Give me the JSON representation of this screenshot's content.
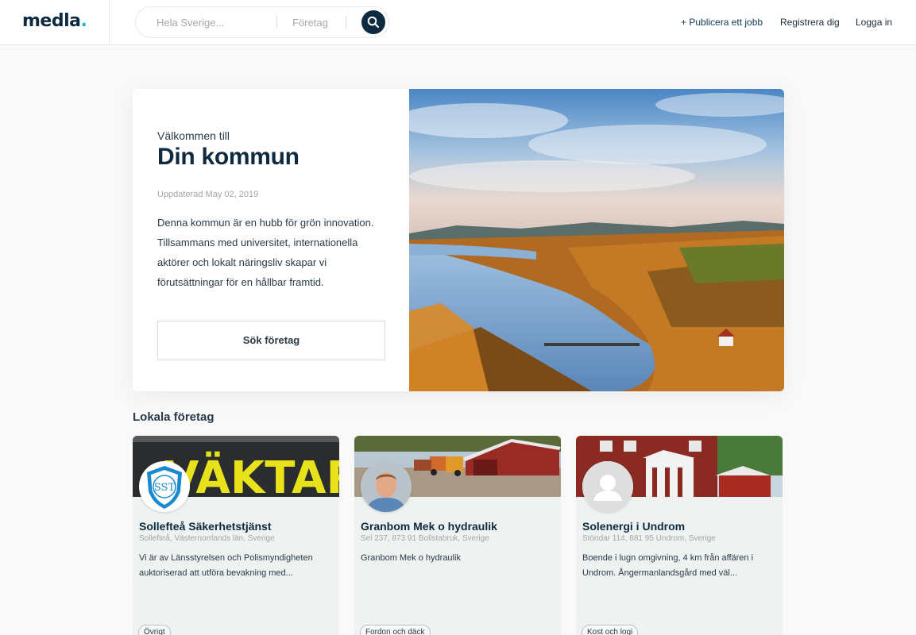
{
  "header": {
    "logo": "medla",
    "logo_dot": ".",
    "search": {
      "location_placeholder": "Hela Sverige...",
      "category_placeholder": "Företag"
    },
    "nav": {
      "publish": "+ Publicera ett jobb",
      "register": "Registrera dig",
      "login": "Logga in"
    }
  },
  "hero": {
    "welcome": "Välkommen till",
    "title": "Din kommun",
    "updated": "Uppdaterad May 02, 2019",
    "description": "Denna kommun är en hubb för grön innovation. Tillsammans med universitet, internationella aktörer och lokalt näringsliv skapar vi förutsättningar för en hållbar framtid.",
    "button": "Sök företag"
  },
  "section": {
    "title": "Lokala företag"
  },
  "companies": [
    {
      "name": "Sollefteå Säkerhetstjänst",
      "address": "Sollefteå, Västernorrlands län, Sverige",
      "description": "Vi är av Länsstyrelsen och Polismyndigheten auktoriserad att utföra bevakning med...",
      "tag": "Övrigt",
      "cover_text": "VÄKTARE",
      "logo_text": "SST"
    },
    {
      "name": "Granbom Mek o hydraulik",
      "address": "Sel 237, 873 91 Bollstabruk, Sverige",
      "description": "Granbom Mek o hydraulik",
      "tag": "Fordon och däck"
    },
    {
      "name": "Solenergi i Undrom",
      "address": "Stöndar 114, 881 95 Undrom, Sverige",
      "description": "Boende i lugn omgivning, 4 km från affären i Undrom. Ångermanlandsgård med väl...",
      "tag": "Kost och logi"
    }
  ]
}
